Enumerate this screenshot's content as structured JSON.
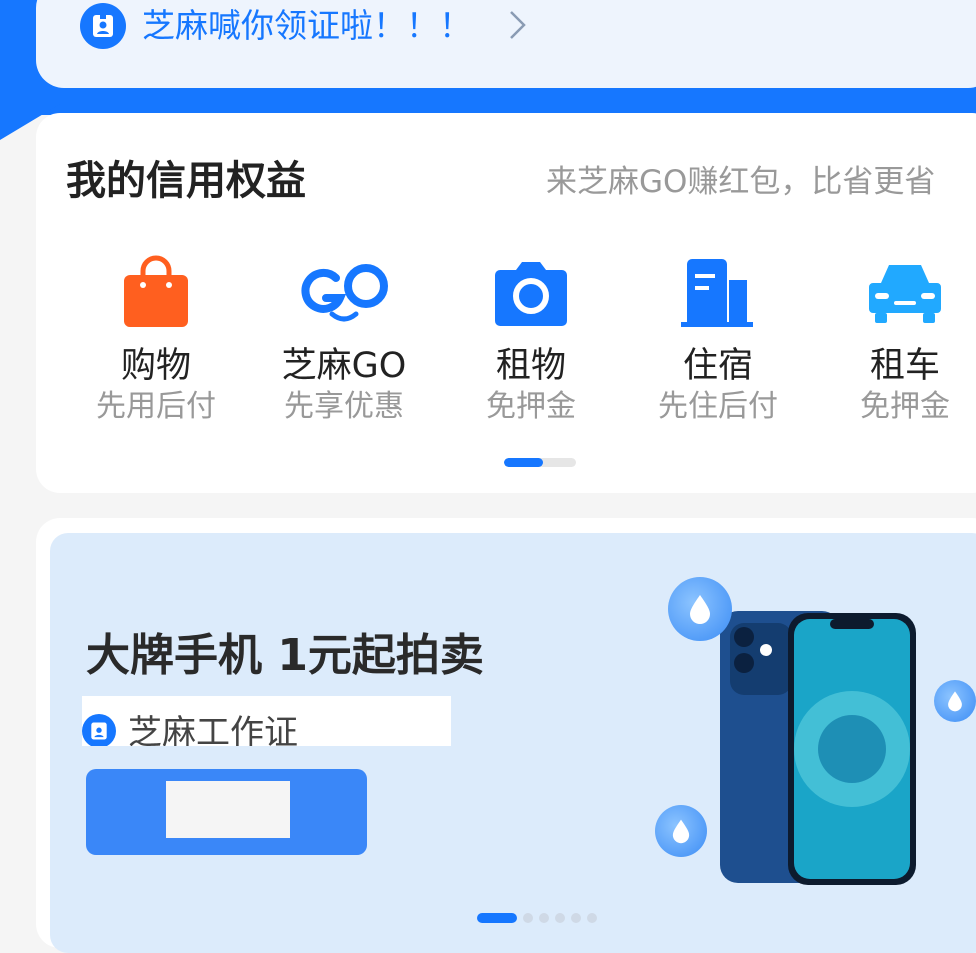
{
  "notice": {
    "text": "芝麻喊你领证啦！！！",
    "icon": "id-badge-icon"
  },
  "benefits": {
    "title": "我的信用权益",
    "subtitle": "来芝麻GO赚红包，比省更省",
    "items": [
      {
        "label": "购物",
        "sub": "先用后付",
        "icon": "shopping-bag-icon",
        "color": "#ff5f1f"
      },
      {
        "label": "芝麻GO",
        "sub": "先享优惠",
        "icon": "go-logo-icon",
        "color": "#1677ff"
      },
      {
        "label": "租物",
        "sub": "免押金",
        "icon": "camera-icon",
        "color": "#1677ff"
      },
      {
        "label": "住宿",
        "sub": "先住后付",
        "icon": "building-icon",
        "color": "#1677ff"
      },
      {
        "label": "租车",
        "sub": "免押金",
        "icon": "car-icon",
        "color": "#21a9ff"
      }
    ],
    "pager_progress": 0.54
  },
  "banner": {
    "title": "大牌手机 1元起拍卖",
    "badge": "芝麻工作证",
    "cta_label": "",
    "slides_total": 6,
    "slide_active": 1
  },
  "colors": {
    "accent": "#1677ff",
    "orange": "#ff5f1f"
  }
}
